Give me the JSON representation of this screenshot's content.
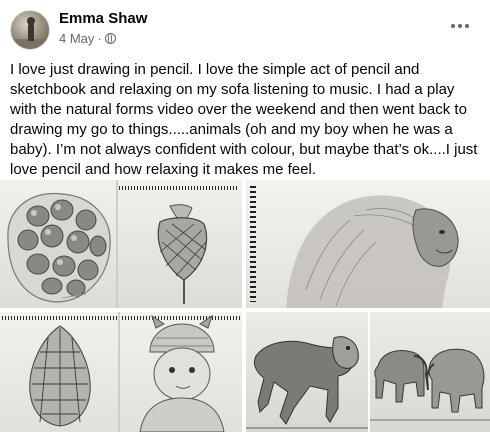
{
  "post": {
    "author": "Emma Shaw",
    "date": "4 May",
    "separator": "·",
    "text": "I love just drawing in pencil. I love the simple act of pencil and sketchbook and relaxing on my sofa listening to music. I had a play with the natural forms video over the weekend and then went back to drawing my go to things.....animals (oh and my boy when he was a baby). I’m not always confident with colour, but maybe that’s ok....I just love pencil and how relaxing it makes me feel.",
    "privacy_icon": "globe-icon",
    "options_icon": "more-options-icon"
  },
  "photos": [
    {
      "subject": "lotus seed head and seed pod pencil drawings"
    },
    {
      "subject": "gorilla pencil drawing in spiral sketchbook"
    },
    {
      "subject": "pine cone and baby in hat pencil drawings"
    },
    {
      "subject": "mandrill pencil drawing"
    },
    {
      "subject": "elephants pencil drawing"
    }
  ],
  "colors": {
    "name": "#050505",
    "meta": "#65676b",
    "text": "#050505"
  }
}
